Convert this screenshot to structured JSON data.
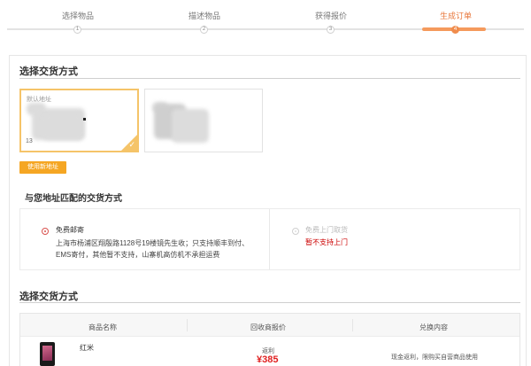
{
  "steps": [
    {
      "label": "选择物品",
      "num": "1"
    },
    {
      "label": "描述物品",
      "num": "2"
    },
    {
      "label": "获得报价",
      "num": "3"
    },
    {
      "label": "生成订单",
      "num": "4"
    }
  ],
  "address_section": {
    "title": "选择交货方式",
    "card_tag": "默认地址",
    "card_num": "13",
    "new_address_button": "使用新地址"
  },
  "method_section": {
    "title": "与您地址匹配的交货方式",
    "option1": {
      "name": "免费邮寄",
      "desc": "上海市杨浦区翔殷路1128号19楼镜先生收；只支持顺丰到付、EMS寄付，其他暂不支持，山寨机高仿机不承担运费"
    },
    "option2": {
      "name": "免费上门取货",
      "warning": "暂不支持上门"
    }
  },
  "product_section": {
    "title": "选择交货方式",
    "headers": [
      "商品名称",
      "回收商报价",
      "兑换内容"
    ],
    "rows": [
      {
        "name": "红米",
        "price_label": "返利",
        "price": "¥385",
        "exchange": "现金返利，限购买自营商品使用"
      }
    ]
  }
}
